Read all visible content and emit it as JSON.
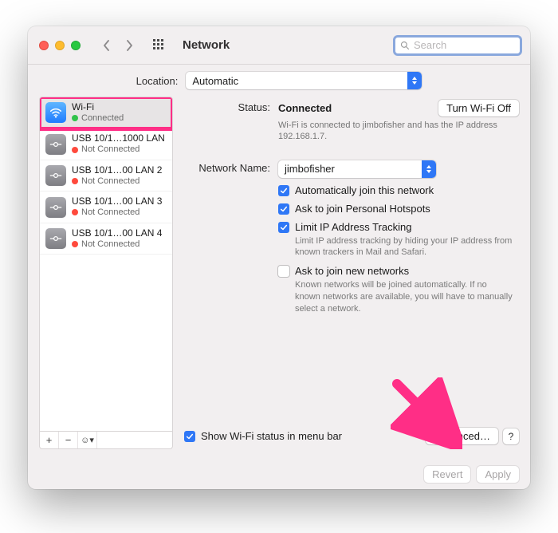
{
  "titlebar": {
    "title": "Network",
    "search_placeholder": "Search"
  },
  "location": {
    "label": "Location:",
    "value": "Automatic"
  },
  "sidebar": {
    "items": [
      {
        "name": "Wi-Fi",
        "status": "Connected",
        "icon": "wifi",
        "dotClass": "green"
      },
      {
        "name": "USB 10/1…1000 LAN",
        "status": "Not Connected",
        "icon": "lan",
        "dotClass": "red"
      },
      {
        "name": "USB 10/1…00 LAN 2",
        "status": "Not Connected",
        "icon": "lan",
        "dotClass": "red"
      },
      {
        "name": "USB 10/1…00 LAN 3",
        "status": "Not Connected",
        "icon": "lan",
        "dotClass": "red"
      },
      {
        "name": "USB 10/1…00 LAN 4",
        "status": "Not Connected",
        "icon": "lan",
        "dotClass": "red"
      }
    ],
    "tool_add": "+",
    "tool_remove": "−",
    "tool_action": "☺︎▾"
  },
  "panel": {
    "status_label": "Status:",
    "status_value": "Connected",
    "turn_off": "Turn Wi-Fi Off",
    "status_help": "Wi-Fi is connected to jimbofisher and has the IP address 192.168.1.7.",
    "network_label": "Network Name:",
    "network_value": "jimbofisher",
    "auto_join": "Automatically join this network",
    "personal_hotspot": "Ask to join Personal Hotspots",
    "limit_tracking": "Limit IP Address Tracking",
    "limit_tracking_help": "Limit IP address tracking by hiding your IP address from known trackers in Mail and Safari.",
    "ask_new": "Ask to join new networks",
    "ask_new_help": "Known networks will be joined automatically. If no known networks are available, you will have to manually select a network.",
    "show_menubar": "Show Wi-Fi status in menu bar",
    "advanced": "Advanced…",
    "help": "?"
  },
  "bottom": {
    "revert": "Revert",
    "apply": "Apply"
  }
}
